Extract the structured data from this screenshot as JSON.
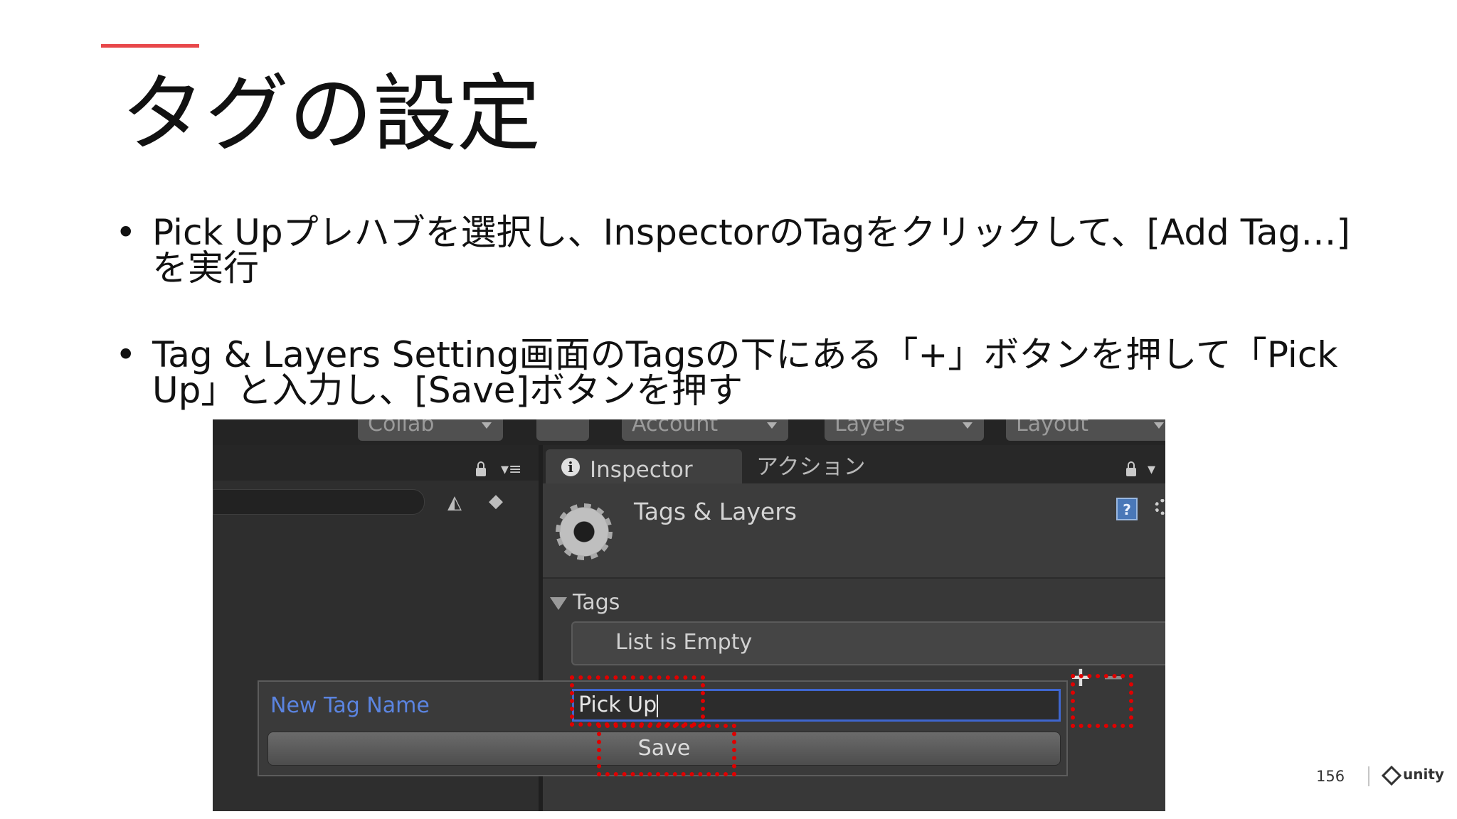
{
  "slide": {
    "title": "タグの設定",
    "page_number": "156",
    "logo_text": "unity",
    "accent_color": "#e8474a"
  },
  "bullets": [
    "Pick Upプレハブを選択し、InspectorのTagをクリックして、[Add Tag…]を実行",
    "Tag & Layers Setting画面のTagsの下にある「+」ボタンを押して「Pick Up」と入力し、[Save]ボタンを押す"
  ],
  "unity": {
    "toolbar": {
      "collab": "Collab",
      "account": "Account",
      "layers": "Layers",
      "layout": "Layout"
    },
    "inspector_tab": "Inspector",
    "action_tab": "アクション",
    "header_title": "Tags & Layers",
    "tags_section": "Tags",
    "list_empty": "List is Empty",
    "plus": "+",
    "minus": "−",
    "help_icon": "?",
    "popup": {
      "label": "New Tag Name",
      "value": "Pick Up",
      "save": "Save"
    },
    "highlight_color": "#e00000"
  }
}
